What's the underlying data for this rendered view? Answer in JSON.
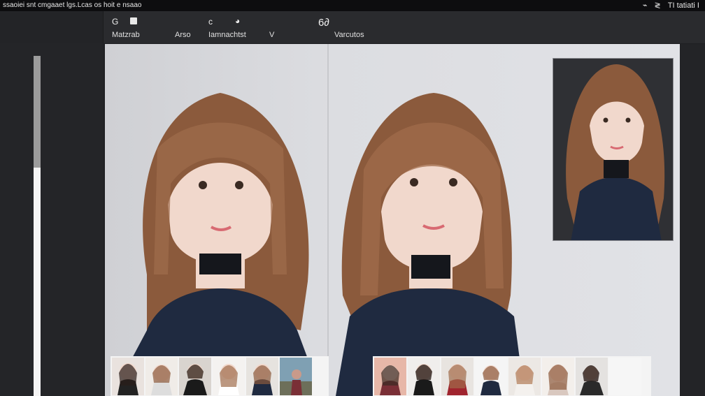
{
  "titlebar": {
    "title": "ssaoiei snt cmgaaet lgs.Lcas os hoit e nsaao",
    "sys_icons": [
      "wave-icon",
      "signal-icon",
      "battery-icon"
    ],
    "sys_text": "TI tatiati I"
  },
  "toolbar": {
    "items": [
      {
        "label": "Matzrab",
        "icon": "circle-c-icon"
      },
      {
        "label": "Arso",
        "icon": "square-icon"
      },
      {
        "label": "Iamnachtst",
        "icon": "c-icon"
      },
      {
        "label": "V",
        "icon": "half-circle-icon"
      },
      {
        "label": "Varcutos",
        "icon": "glyph-65-icon"
      }
    ],
    "glyph": "6∂"
  },
  "colors": {
    "hair": "#8b5a3c",
    "hair_light": "#b07a55",
    "skin": "#f1d8cc",
    "sweater": "#1f2a40",
    "backdrop": "#dcdde1",
    "inset_bg": "#2f3034"
  },
  "thumbnails": {
    "left_count": 6,
    "right_count": 8
  }
}
